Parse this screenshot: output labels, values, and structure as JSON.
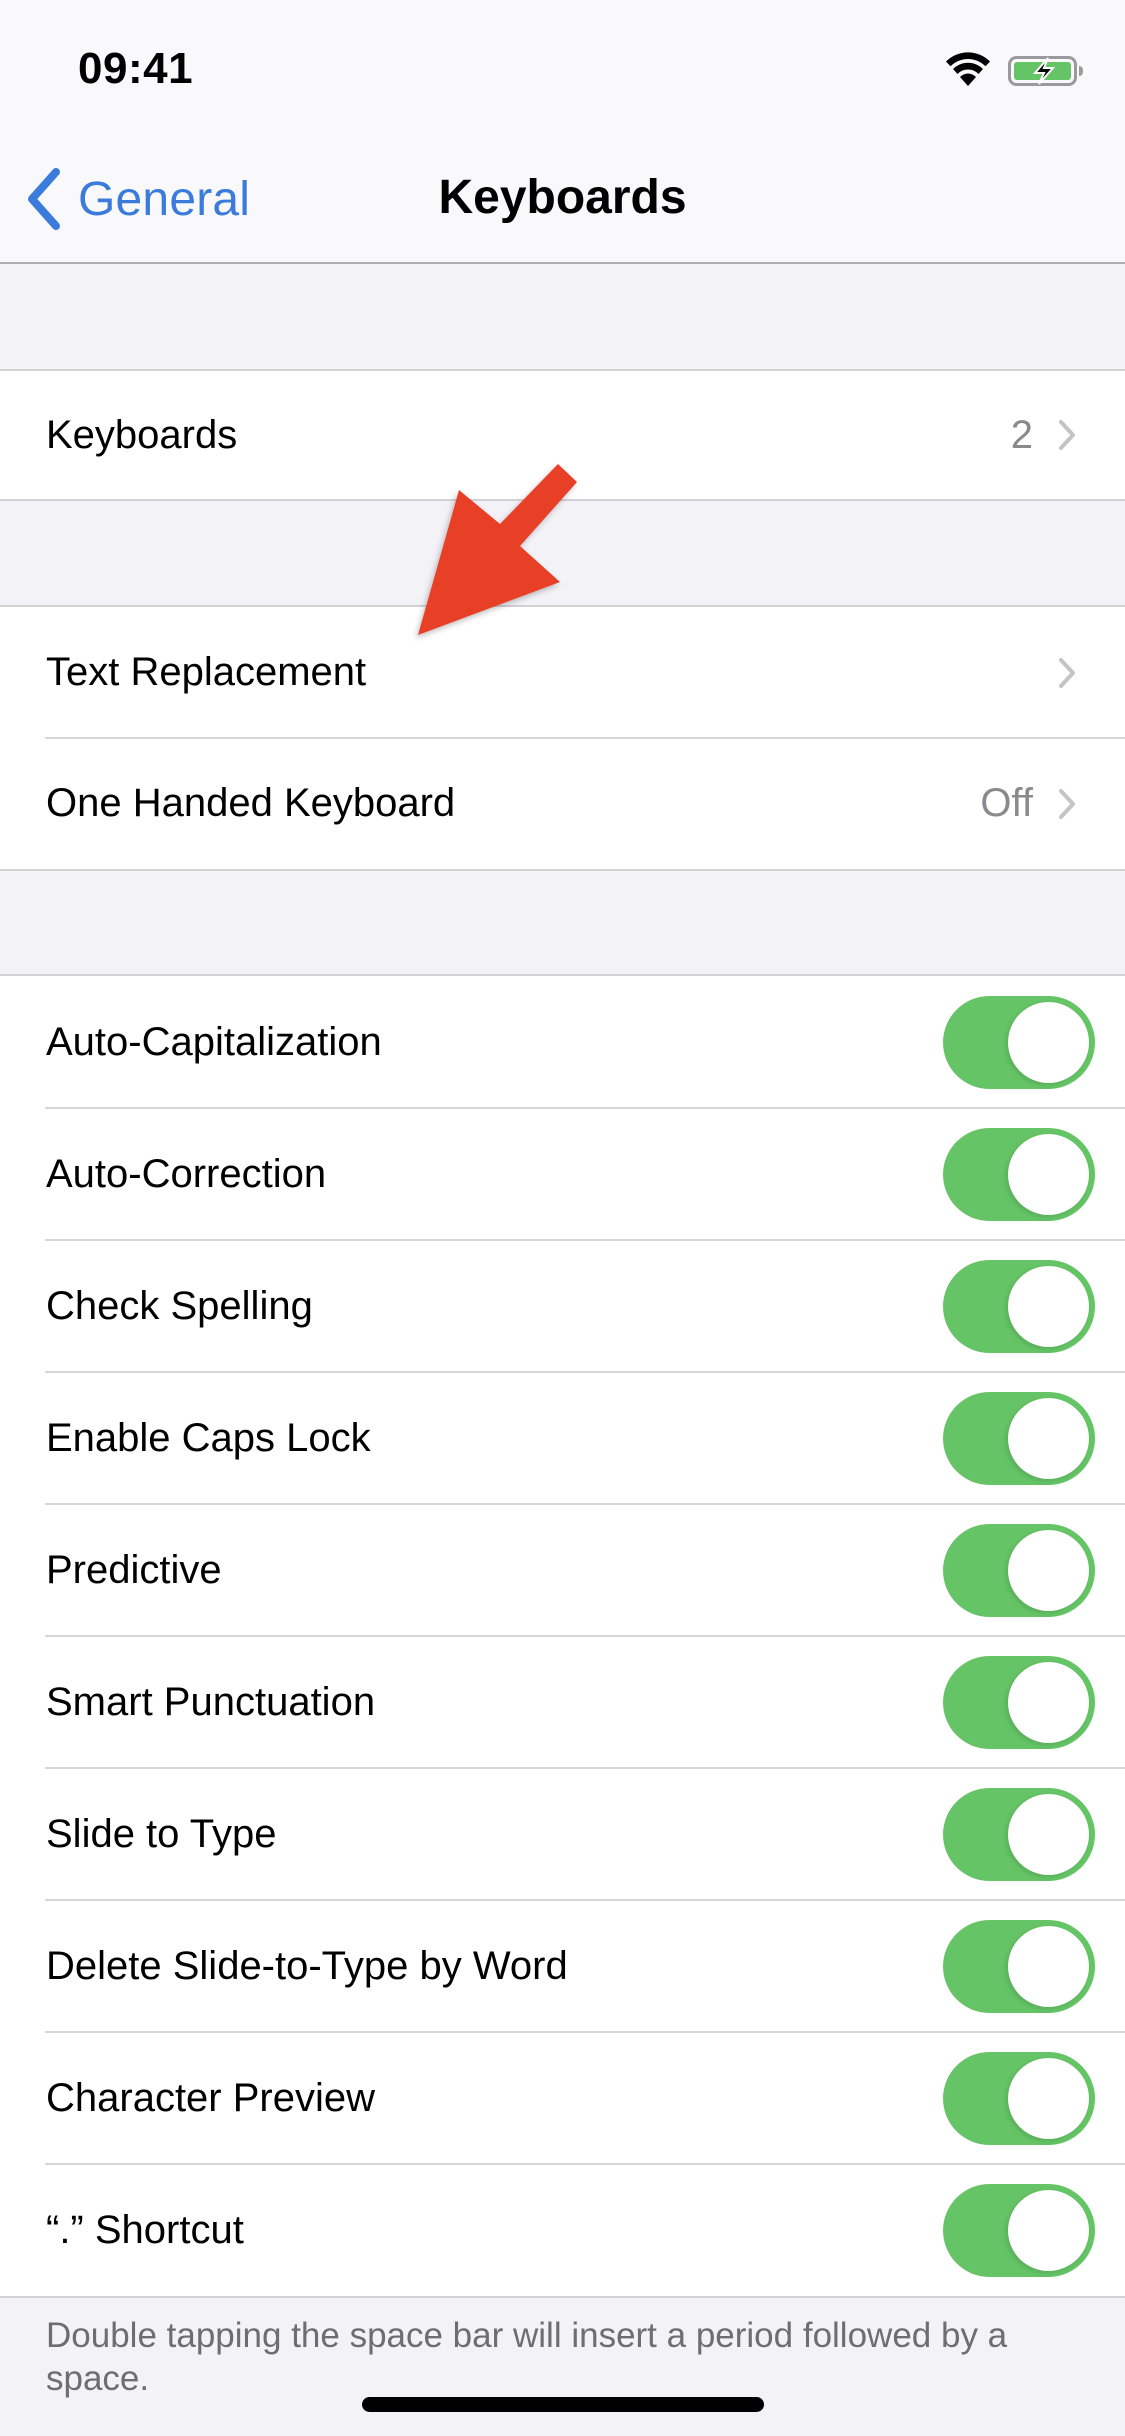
{
  "status_bar": {
    "time": "09:41",
    "wifi_icon": "wifi-icon",
    "battery_icon": "battery-charging-icon",
    "battery_level_percent": 90
  },
  "nav": {
    "back_label": "General",
    "back_icon": "chevron-left-icon",
    "title": "Keyboards"
  },
  "groups": {
    "keyboards": {
      "label": "Keyboards",
      "value": "2"
    },
    "text": [
      {
        "label": "Text Replacement",
        "value": ""
      },
      {
        "label": "One Handed Keyboard",
        "value": "Off"
      }
    ],
    "toggles": [
      {
        "label": "Auto-Capitalization",
        "on": true
      },
      {
        "label": "Auto-Correction",
        "on": true
      },
      {
        "label": "Check Spelling",
        "on": true
      },
      {
        "label": "Enable Caps Lock",
        "on": true
      },
      {
        "label": "Predictive",
        "on": true
      },
      {
        "label": "Smart Punctuation",
        "on": true
      },
      {
        "label": "Slide to Type",
        "on": true
      },
      {
        "label": "Delete Slide-to-Type by Word",
        "on": true
      },
      {
        "label": "Character Preview",
        "on": true
      },
      {
        "label": "“.” Shortcut",
        "on": true
      }
    ]
  },
  "footer_note": "Double tapping the space bar will insert a period followed by a space.",
  "annotation": {
    "type": "red-arrow",
    "points_to": "Text Replacement"
  },
  "colors": {
    "accent_blue": "#3A7BDB",
    "toggle_on_green": "#65C466",
    "arrow_red": "#E84127",
    "secondary_text": "#8A8A8E",
    "page_background": "#F2F2F7"
  }
}
